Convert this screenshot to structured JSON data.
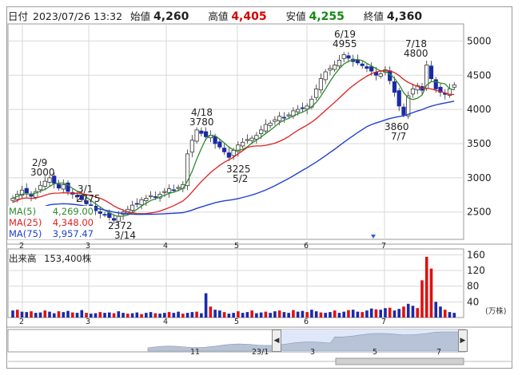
{
  "header": {
    "date_label": "日付",
    "datetime": "2023/07/26 13:32",
    "open_label": "始値",
    "open": "4,260",
    "high_label": "高値",
    "high": "4,405",
    "low_label": "安値",
    "low": "4,255",
    "close_label": "終値",
    "close": "4,360"
  },
  "ma": [
    {
      "label": "MA(5)",
      "value": "4,269.00",
      "color": "#2e8b2e"
    },
    {
      "label": "MA(25)",
      "value": "4,348.00",
      "color": "#e02020"
    },
    {
      "label": "MA(75)",
      "value": "3,957.47",
      "color": "#2040d0"
    }
  ],
  "volume": {
    "label": "出来高",
    "value": "153,400株",
    "unit": "(万株)"
  },
  "navigator": {
    "left_arrow": "◀",
    "right_arrow": "▶",
    "ticks": [
      "11",
      "23/1",
      "3",
      "5",
      "7"
    ]
  },
  "colors": {
    "up": "#1a2aa8",
    "down": "#e01010",
    "ma5": "#2e8b2e",
    "ma25": "#e02020",
    "ma75": "#2040d0",
    "grid": "#d8d8d8"
  },
  "chart_data": {
    "type": "candlestick",
    "price_axis": {
      "ticks": [
        2500,
        3000,
        3500,
        4000,
        4500,
        5000
      ],
      "ylim": [
        2100,
        5250
      ]
    },
    "volume_axis": {
      "ticks": [
        40,
        80,
        120,
        160
      ],
      "ylim": [
        0,
        175
      ],
      "unit": "(万株)"
    },
    "x_ticks": [
      "2",
      "3",
      "4",
      "5",
      "6",
      "7"
    ],
    "annotations": [
      {
        "label": "2/9",
        "value": "3000"
      },
      {
        "label": "3/1",
        "value": "2775"
      },
      {
        "label": "2372",
        "sub": "3/14"
      },
      {
        "label": "4/18",
        "value": "3780"
      },
      {
        "label": "3225",
        "sub": "5/2"
      },
      {
        "label": "6/19",
        "value": "4955"
      },
      {
        "label": "7/18",
        "value": "4800"
      },
      {
        "label": "3860",
        "sub": "7/7"
      }
    ],
    "close_series": [
      2700,
      2760,
      2820,
      2780,
      2730,
      2800,
      2890,
      2950,
      3000,
      2920,
      2850,
      2900,
      2800,
      2760,
      2720,
      2680,
      2620,
      2560,
      2520,
      2480,
      2460,
      2420,
      2380,
      2440,
      2500,
      2540,
      2600,
      2620,
      2680,
      2700,
      2740,
      2720,
      2760,
      2800,
      2840,
      2820,
      2860,
      2900,
      3350,
      3550,
      3700,
      3650,
      3600,
      3620,
      3500,
      3450,
      3380,
      3300,
      3400,
      3480,
      3520,
      3560,
      3580,
      3620,
      3700,
      3780,
      3800,
      3850,
      3900,
      3880,
      3920,
      3980,
      4000,
      4020,
      4050,
      4150,
      4300,
      4450,
      4550,
      4600,
      4650,
      4720,
      4800,
      4750,
      4700,
      4680,
      4640,
      4600,
      4560,
      4500,
      4520,
      4580,
      4420,
      4250,
      4050,
      3920,
      4200,
      4300,
      4350,
      4280,
      4650,
      4450,
      4300,
      4250,
      4220,
      4300,
      4360
    ],
    "volume_series": [
      18,
      20,
      15,
      14,
      16,
      12,
      13,
      18,
      15,
      11,
      16,
      14,
      17,
      13,
      12,
      19,
      12,
      10,
      11,
      14,
      12,
      13,
      11,
      16,
      12,
      10,
      11,
      13,
      9,
      12,
      14,
      11,
      10,
      12,
      14,
      12,
      15,
      10,
      12,
      14,
      15,
      11,
      62,
      28,
      20,
      18,
      14,
      10,
      12,
      16,
      12,
      14,
      18,
      11,
      13,
      15,
      12,
      16,
      18,
      14,
      12,
      19,
      15,
      17,
      14,
      20,
      16,
      13,
      12,
      14,
      18,
      12,
      15,
      19,
      20,
      15,
      14,
      18,
      23,
      21,
      20,
      24,
      25,
      18,
      22,
      28,
      35,
      30,
      24,
      95,
      155,
      125,
      40,
      28,
      20,
      14,
      12
    ]
  }
}
